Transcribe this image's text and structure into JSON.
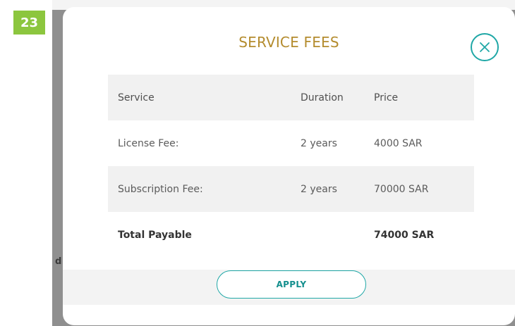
{
  "step_badge": "23",
  "backdrop_text": "d",
  "modal": {
    "title": "SERVICE FEES",
    "close_icon": "close-x-circle-icon",
    "table": {
      "headers": [
        "Service",
        "Duration",
        "Price"
      ],
      "rows": [
        {
          "service": "License Fee:",
          "duration": "2 years",
          "price": "4000 SAR"
        },
        {
          "service": "Subscription Fee:",
          "duration": "2 years",
          "price": "70000 SAR"
        }
      ],
      "total": {
        "label": "Total Payable",
        "price": "74000 SAR"
      }
    },
    "apply_label": "APPLY"
  },
  "colors": {
    "title": "#b48c2e",
    "accent": "#1fa7a6",
    "badge": "#8cc63e",
    "row_shade": "#f1f1f1"
  }
}
